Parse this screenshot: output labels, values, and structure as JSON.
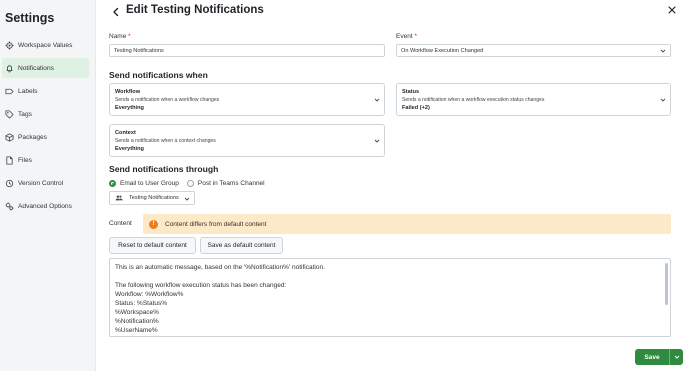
{
  "sidebar": {
    "title": "Settings",
    "items": [
      {
        "label": "Workspace Values",
        "icon": "gear-icon"
      },
      {
        "label": "Notifications",
        "icon": "bell-icon",
        "active": true
      },
      {
        "label": "Labels",
        "icon": "label-icon"
      },
      {
        "label": "Tags",
        "icon": "tag-icon"
      },
      {
        "label": "Packages",
        "icon": "package-icon"
      },
      {
        "label": "Files",
        "icon": "file-icon"
      },
      {
        "label": "Version Control",
        "icon": "version-control-icon"
      },
      {
        "label": "Advanced Options",
        "icon": "advanced-options-icon"
      }
    ]
  },
  "header": {
    "title": "Edit Testing Notifications"
  },
  "form": {
    "name_label": "Name",
    "name_required": "*",
    "name_value": "Testing Notifications",
    "event_label": "Event",
    "event_required": "*",
    "event_value": "On Workflow Execution Changed"
  },
  "send_when": {
    "title": "Send notifications when",
    "cards": [
      {
        "title": "Workflow",
        "description": "Sends a notification when a workflow changes",
        "value": "Everything"
      },
      {
        "title": "Status",
        "description": "Sends a notification when a workflow execution status changes",
        "value": "Failed (+2)"
      },
      {
        "title": "Context",
        "description": "Sends a notification when a context changes",
        "value": "Everything"
      }
    ]
  },
  "send_through": {
    "title": "Send notifications through",
    "options": [
      {
        "label": "Email to User Group",
        "selected": true
      },
      {
        "label": "Post in Teams Channel",
        "selected": false
      }
    ],
    "group_value": "Testing Notifications"
  },
  "content": {
    "label": "Content",
    "alert": "Content differs from default content",
    "reset_button": "Reset to default content",
    "save_default_button": "Save as default content",
    "lines": [
      "This is an automatic message, based on the '%Notification%' notification.",
      "",
      "The following workflow execution status has been changed:",
      "Workflow: %Workflow%",
      "Status: %Status%",
      "%Workspace%",
      "%Notification%",
      "%UserName%"
    ]
  },
  "footer": {
    "save_label": "Save"
  },
  "colors": {
    "accent": "#2e8b3f",
    "active_nav_bg": "#dff1e2",
    "alert_bg": "#fde8c8",
    "warning": "#e67e22"
  }
}
